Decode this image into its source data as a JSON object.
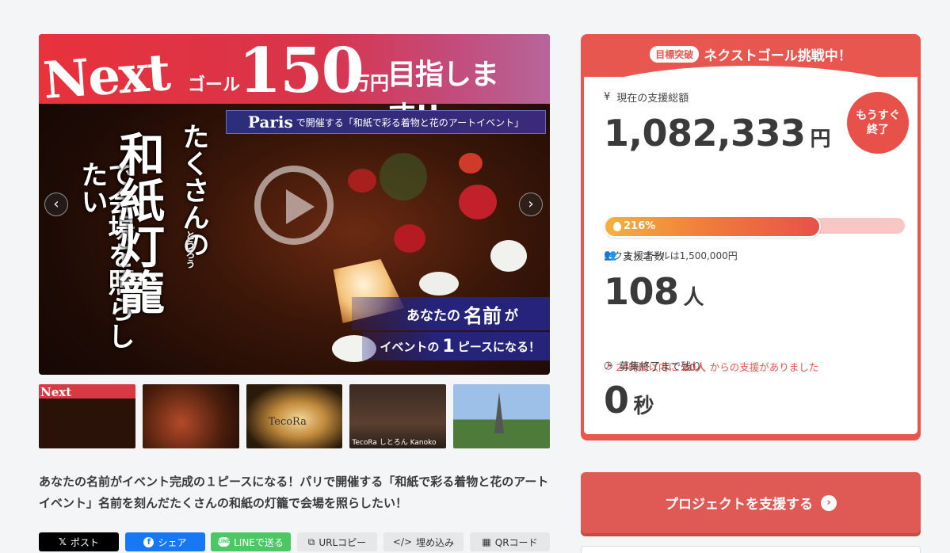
{
  "hero": {
    "next": "Next",
    "goal_small": "ゴール",
    "big_number": "150",
    "man_yen": "万円",
    "aim": "目指します!!",
    "paris_prefix": "Paris",
    "paris_text": "で開催する「和紙で彩る着物と花のアートイベント」",
    "vertical_1": "で会場を照らしたい",
    "vertical_2": "和紙灯籠",
    "vertical_3": "たくさんの",
    "ruby": "とうろう",
    "band1_pre": "あなたの",
    "band1_big": "名前",
    "band1_post": "が",
    "band2_pre": "イベントの",
    "band2_big": "1",
    "band2_post": "ピースになる！",
    "prev_arrow": "‹",
    "next_arrow": "›"
  },
  "thumbnails": [
    {
      "label": "Next"
    },
    {
      "label": ""
    },
    {
      "label": "TecoRa"
    },
    {
      "label": "TecoRa  しとろん  Kanoko"
    },
    {
      "label": ""
    }
  ],
  "description": "あなたの名前がイベント完成の１ピースになる！パリで開催する「和紙で彩る着物と花のアートイベント」名前を刻んだたくさんの和紙の灯籠で会場を照らしたい！",
  "share": {
    "x": "ポスト",
    "facebook": "シェア",
    "line": "LINEで送る",
    "url": "URLコピー",
    "embed": "埋め込み",
    "qr": "QRコード"
  },
  "card": {
    "badge": "目標突破",
    "title": "ネクストゴール挑戦中！",
    "total_label": "現在の支援総額",
    "total_value": "1,082,333",
    "total_unit": "円",
    "soon_line1": "もうすぐ",
    "soon_line2": "終了",
    "progress_text": "216%",
    "progress_fraction": 0.72,
    "next_goal": "ネクストゴールは1,500,000円",
    "supporters_label": "支援者数",
    "supporters_value": "108",
    "supporters_unit": "人",
    "trend_pre": "24時間以内に",
    "trend_num": "20人",
    "trend_post": "からの支援がありました",
    "remain_label": "募集終了まで残り",
    "remain_value": "0",
    "remain_unit": "秒"
  },
  "cta": "プロジェクトを支援する",
  "colors": {
    "accent": "#e85650",
    "bar_start": "#f6b03f"
  }
}
